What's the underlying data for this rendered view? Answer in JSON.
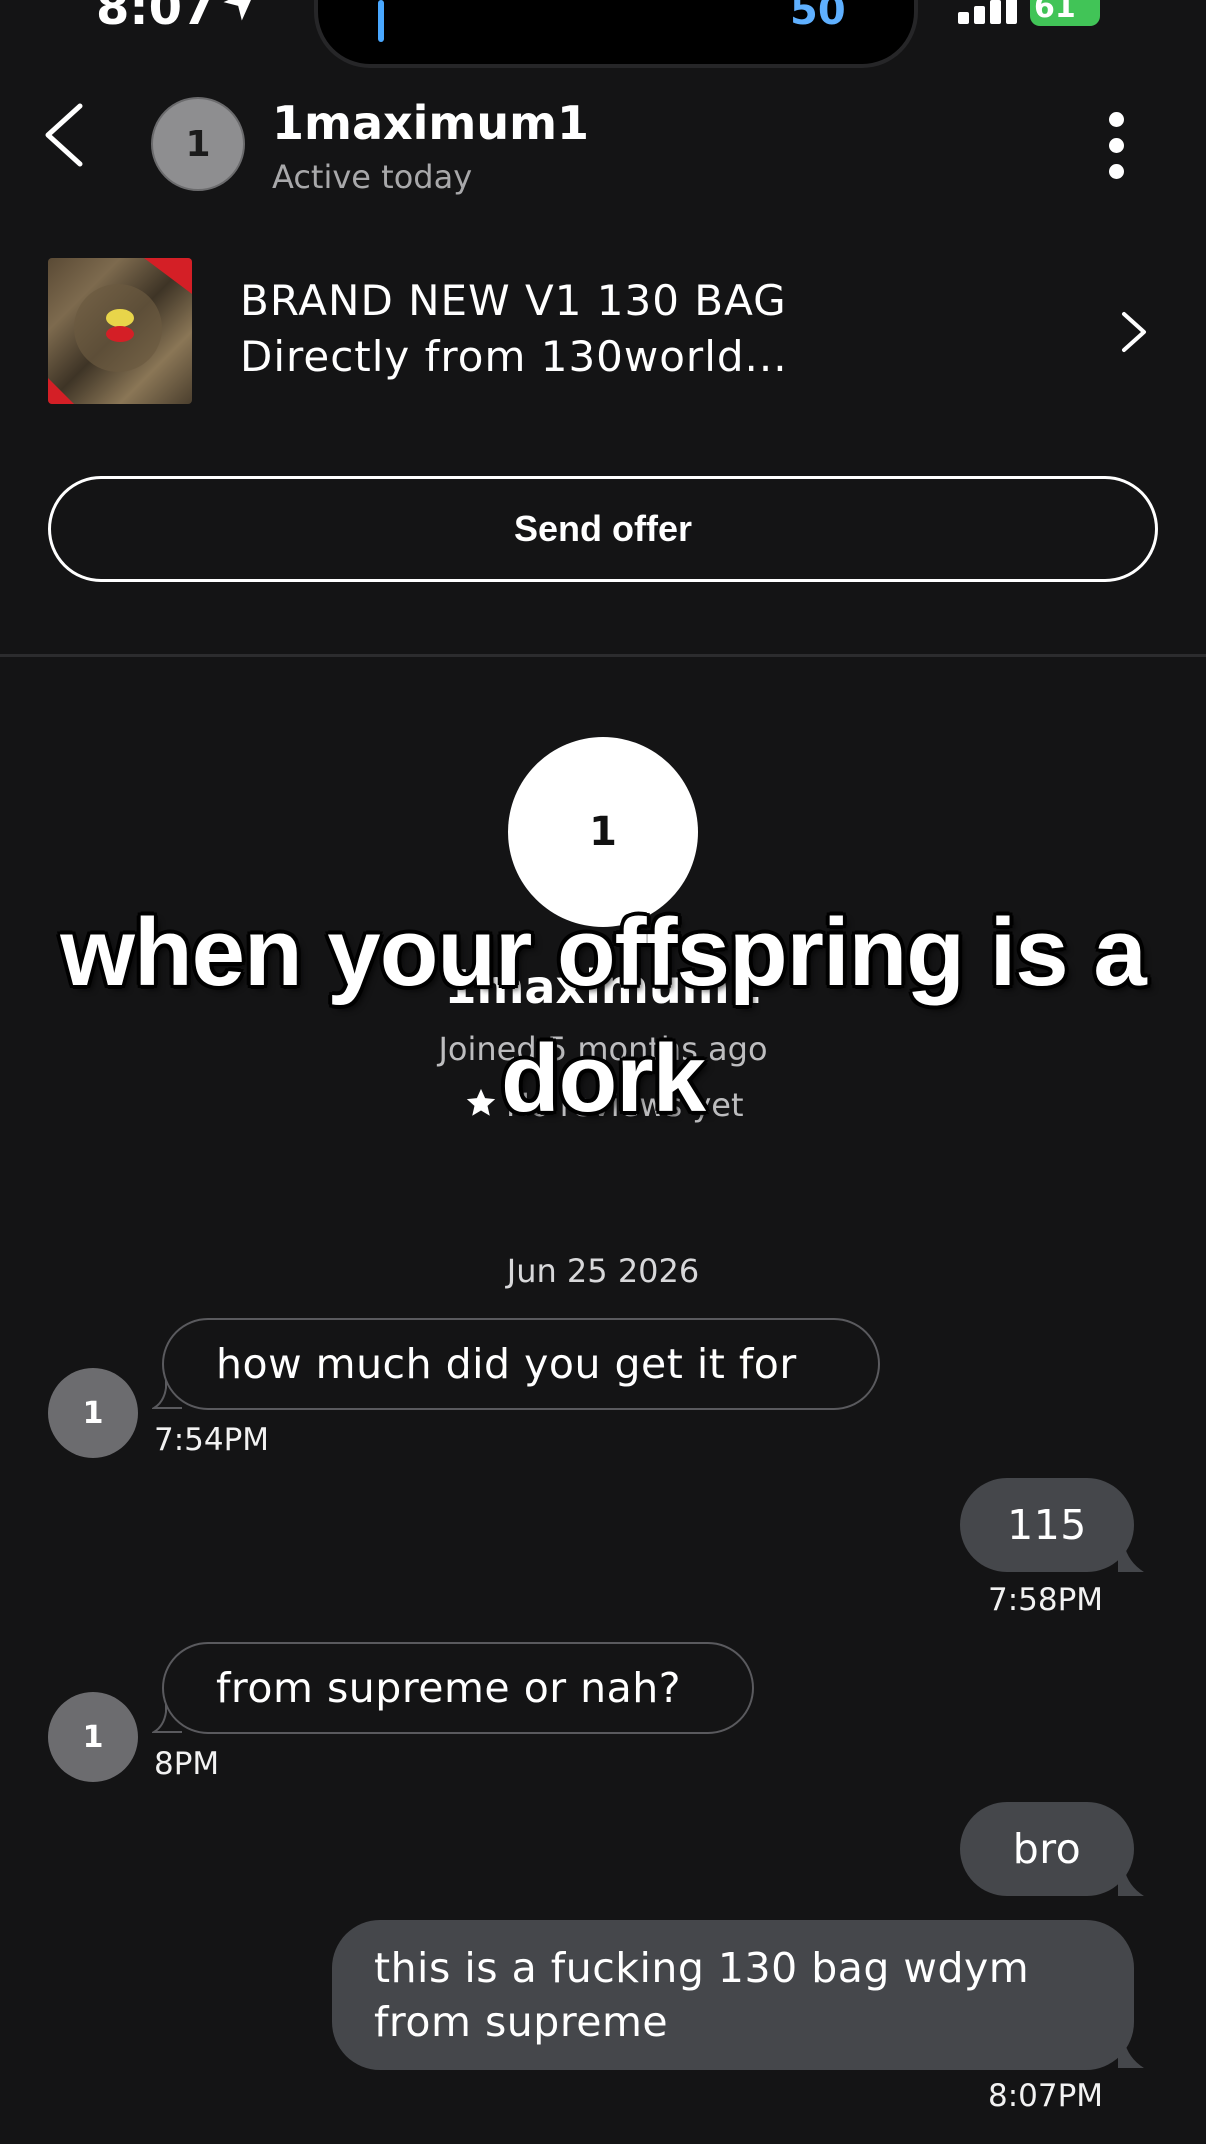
{
  "status_bar": {
    "time": "8:07",
    "island_text": "50",
    "battery": "61"
  },
  "header": {
    "avatar_letter": "1",
    "username": "1maximum1",
    "status": "Active today"
  },
  "listing": {
    "title": "BRAND NEW V1 130 BAG",
    "subtitle": "Directly from 130world..."
  },
  "offer_button": {
    "label": "Send offer"
  },
  "profile": {
    "avatar_letter": "1",
    "name": "1maximum1",
    "joined": "Joined 5 months ago",
    "reviews": "No reviews yet"
  },
  "caption": {
    "line1": "when your offspring is a",
    "line2": "dork"
  },
  "chat": {
    "date": "Jun 25 2026",
    "messages": [
      {
        "from": "them",
        "avatar": "1",
        "text": "how much did you get it for",
        "time": "7:54PM"
      },
      {
        "from": "me",
        "text": "115",
        "time": "7:58PM"
      },
      {
        "from": "them",
        "avatar": "1",
        "text": "from supreme or nah?",
        "time": "8PM"
      },
      {
        "from": "me",
        "text": "bro",
        "time": ""
      },
      {
        "from": "me",
        "text_line1": "this is a fucking 130 bag wdym",
        "text_line2": "from supreme",
        "time": "8:07PM"
      }
    ]
  },
  "colors": {
    "background": "#141415",
    "outgoing_bubble": "#45474b",
    "incoming_border": "#5a5a5e",
    "battery": "#41c457",
    "island_accent": "#5fb0ff"
  },
  "icons": [
    "location-arrow-icon",
    "signal-icon",
    "battery-icon",
    "back-chevron-icon",
    "more-vertical-icon",
    "chevron-right-icon",
    "star-icon"
  ]
}
